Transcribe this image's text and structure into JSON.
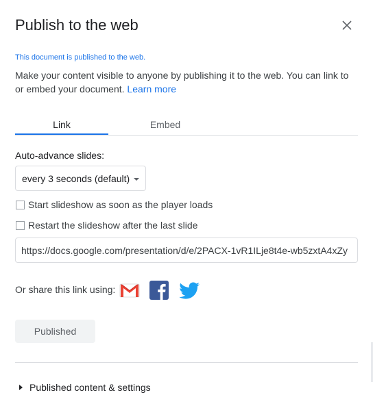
{
  "dialog": {
    "title": "Publish to the web",
    "status": "This document is published to the web.",
    "description": "Make your content visible to anyone by publishing it to the web. You can link to or embed your document.",
    "learn_more": "Learn more"
  },
  "tabs": [
    {
      "label": "Link",
      "active": true
    },
    {
      "label": "Embed",
      "active": false
    }
  ],
  "auto_advance": {
    "label": "Auto-advance slides:",
    "selected": "every 3 seconds (default)"
  },
  "options": [
    {
      "label": "Start slideshow as soon as the player loads",
      "checked": false
    },
    {
      "label": "Restart the slideshow after the last slide",
      "checked": false
    }
  ],
  "link_field": {
    "value": "https://docs.google.com/presentation/d/e/2PACX-1vR1ILje8t4e-wb5zxtA4xZy"
  },
  "share": {
    "label": "Or share this link using:",
    "icons": [
      "gmail-icon",
      "facebook-icon",
      "twitter-icon"
    ]
  },
  "published_button": "Published",
  "settings_toggle": "Published content & settings",
  "colors": {
    "accent": "#1a73e8",
    "gmail_red": "#ea4335",
    "facebook_blue": "#3b5998",
    "twitter_blue": "#1da1f2"
  }
}
